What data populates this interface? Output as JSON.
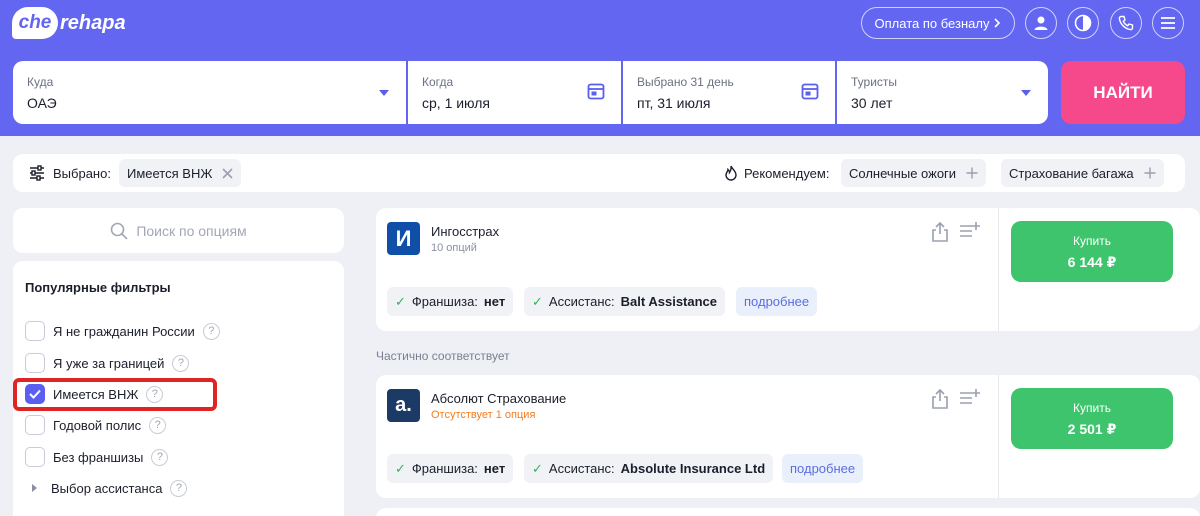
{
  "header": {
    "logo_mark": "che",
    "logo_text": "rehapa",
    "pay_button": "Оплата по безналу",
    "icons": [
      "user-icon",
      "contrast-icon",
      "phone-icon",
      "menu-icon"
    ],
    "colors": {
      "brand": "#6366f1",
      "accent": "#f5498b",
      "success": "#3ec46d"
    }
  },
  "search": {
    "fields": [
      {
        "label": "Куда",
        "value": "ОАЭ",
        "icon": "dropdown-arrow-icon"
      },
      {
        "label": "Когда",
        "value": "ср, 1 июля",
        "icon": "calendar-icon"
      },
      {
        "label": "Выбрано 31 день",
        "value": "пт, 31 июля",
        "icon": "calendar-icon"
      },
      {
        "label": "Туристы",
        "value": "30 лет",
        "icon": "dropdown-arrow-icon"
      }
    ],
    "find_button": "НАЙТИ"
  },
  "filter_bar": {
    "selected_label": "Выбрано:",
    "selected_chips": [
      "Имеется ВНЖ"
    ],
    "recommend_label": "Рекомендуем:",
    "recommend_chips": [
      "Солнечные ожоги",
      "Страхование багажа"
    ]
  },
  "sidebar": {
    "search_placeholder": "Поиск по опциям",
    "title": "Популярные фильтры",
    "filters": [
      {
        "label": "Я не гражданин России",
        "checked": false
      },
      {
        "label": "Я уже за границей",
        "checked": false
      },
      {
        "label": "Имеется ВНЖ",
        "checked": true
      },
      {
        "label": "Годовой полис",
        "checked": false
      },
      {
        "label": "Без франшизы",
        "checked": false
      }
    ],
    "expander": "Выбор ассистанса",
    "help_glyph": "?"
  },
  "results": {
    "partial_label": "Частично соответствует",
    "cards": [
      {
        "logo_letter": "И",
        "logo_color": "#0f4fa8",
        "name": "Ингосстрах",
        "sub": "10 опций",
        "franchise_label": "Франшиза:",
        "franchise_value": "нет",
        "assist_label": "Ассистанс:",
        "assist_value": "Balt Assistance",
        "more": "подробнее",
        "buy_label": "Купить",
        "price": "6 144 ₽"
      },
      {
        "logo_letter": "a.",
        "logo_color": "#1b3a66",
        "name": "Абсолют Страхование",
        "sub": "Отсутствует 1 опция",
        "franchise_label": "Франшиза:",
        "franchise_value": "нет",
        "assist_label": "Ассистанс:",
        "assist_value": "Absolute Insurance Ltd",
        "more": "подробнее",
        "buy_label": "Купить",
        "price": "2 501 ₽"
      }
    ]
  }
}
